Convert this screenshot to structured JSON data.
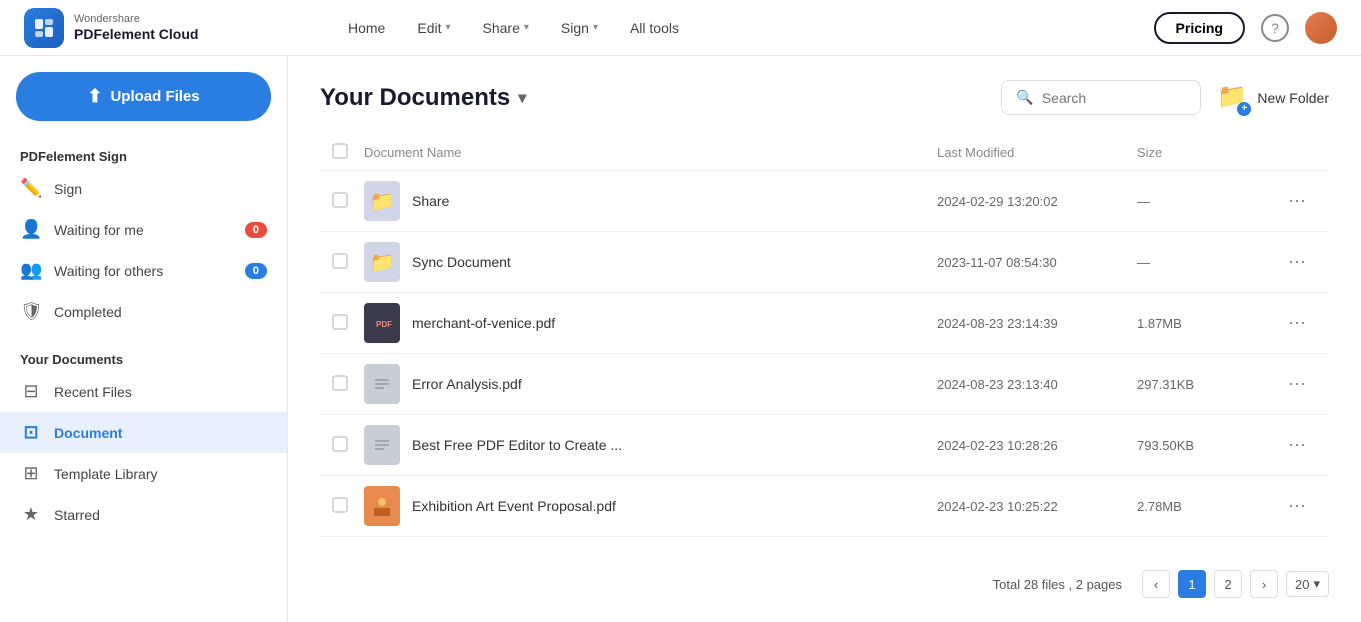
{
  "topnav": {
    "logo": {
      "brand_top": "Wondershare",
      "brand_bottom": "PDFelement Cloud"
    },
    "links": [
      {
        "label": "Home",
        "has_dropdown": false
      },
      {
        "label": "Edit",
        "has_dropdown": true
      },
      {
        "label": "Share",
        "has_dropdown": true
      },
      {
        "label": "Sign",
        "has_dropdown": true
      },
      {
        "label": "All tools",
        "has_dropdown": false
      }
    ],
    "pricing_label": "Pricing",
    "help_symbol": "?"
  },
  "sidebar": {
    "upload_label": "Upload Files",
    "sign_section_title": "PDFelement Sign",
    "sign_label": "Sign",
    "waiting_for_me_label": "Waiting for me",
    "waiting_for_me_badge": "0",
    "waiting_for_others_label": "Waiting for others",
    "waiting_for_others_badge": "0",
    "completed_label": "Completed",
    "docs_section_title": "Your Documents",
    "recent_files_label": "Recent Files",
    "document_label": "Document",
    "template_library_label": "Template Library",
    "starred_label": "Starred"
  },
  "main": {
    "title": "Your Documents",
    "search_placeholder": "Search",
    "new_folder_label": "New Folder",
    "table_headers": {
      "name": "Document Name",
      "modified": "Last Modified",
      "size": "Size"
    },
    "rows": [
      {
        "type": "folder",
        "name": "Share",
        "modified": "2024-02-29 13:20:02",
        "size": "—"
      },
      {
        "type": "folder",
        "name": "Sync Document",
        "modified": "2023-11-07 08:54:30",
        "size": "—"
      },
      {
        "type": "pdf-dark",
        "name": "merchant-of-venice.pdf",
        "modified": "2024-08-23 23:14:39",
        "size": "1.87MB"
      },
      {
        "type": "pdf-gray",
        "name": "Error Analysis.pdf",
        "modified": "2024-08-23 23:13:40",
        "size": "297.31KB"
      },
      {
        "type": "pdf-gray",
        "name": "Best Free PDF Editor to Create ...",
        "modified": "2024-02-23 10:28:26",
        "size": "793.50KB"
      },
      {
        "type": "pdf-orange",
        "name": "Exhibition Art Event Proposal.pdf",
        "modified": "2024-02-23 10:25:22",
        "size": "2.78MB"
      }
    ],
    "pagination": {
      "total_info": "Total 28 files , 2 pages",
      "current_page": 1,
      "total_pages": 2,
      "per_page": "20"
    }
  }
}
